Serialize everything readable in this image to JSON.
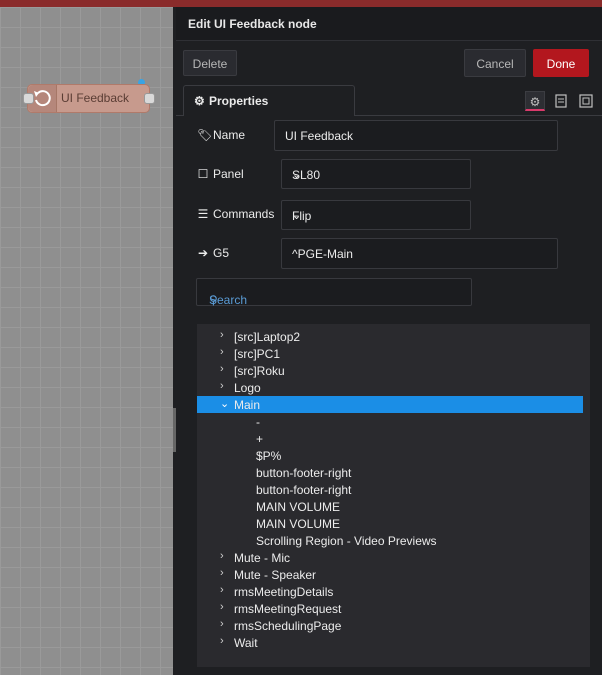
{
  "flow": {
    "node_label": "UI Feedback"
  },
  "tray": {
    "title": "Edit UI Feedback node",
    "delete_label": "Delete",
    "cancel_label": "Cancel",
    "done_label": "Done",
    "tab_properties": "Properties"
  },
  "form": {
    "name_label": "Name",
    "name_value": "UI Feedback",
    "panel_label": "Panel",
    "panel_value": "SL80",
    "commands_label": "Commands",
    "commands_value": "Flip",
    "g5_label": "G5",
    "g5_value": "^PGE-Main",
    "search_placeholder": "Search"
  },
  "tree": {
    "items": [
      {
        "label": "[src]Laptop2",
        "arrow": "›"
      },
      {
        "label": "[src]PC1",
        "arrow": "›"
      },
      {
        "label": "[src]Roku",
        "arrow": "›"
      },
      {
        "label": "Logo",
        "arrow": "›"
      },
      {
        "label": "Main",
        "arrow": "⌄"
      },
      {
        "label": "-",
        "arrow": ""
      },
      {
        "label": "+",
        "arrow": ""
      },
      {
        "label": "$P%",
        "arrow": ""
      },
      {
        "label": "button-footer-right",
        "arrow": ""
      },
      {
        "label": "button-footer-right",
        "arrow": ""
      },
      {
        "label": "MAIN VOLUME",
        "arrow": ""
      },
      {
        "label": "MAIN VOLUME",
        "arrow": ""
      },
      {
        "label": "Scrolling Region - Video Previews",
        "arrow": ""
      },
      {
        "label": "Mute - Mic",
        "arrow": "›"
      },
      {
        "label": "Mute - Speaker",
        "arrow": "›"
      },
      {
        "label": "rmsMeetingDetails",
        "arrow": "›"
      },
      {
        "label": "rmsMeetingRequest",
        "arrow": "›"
      },
      {
        "label": "rmsSchedulingPage",
        "arrow": "›"
      },
      {
        "label": "Wait",
        "arrow": "›"
      }
    ]
  },
  "colors": {
    "accent": "#b3171e",
    "selection": "#1b8ee6",
    "tab_highlight": "#d93a6b"
  }
}
